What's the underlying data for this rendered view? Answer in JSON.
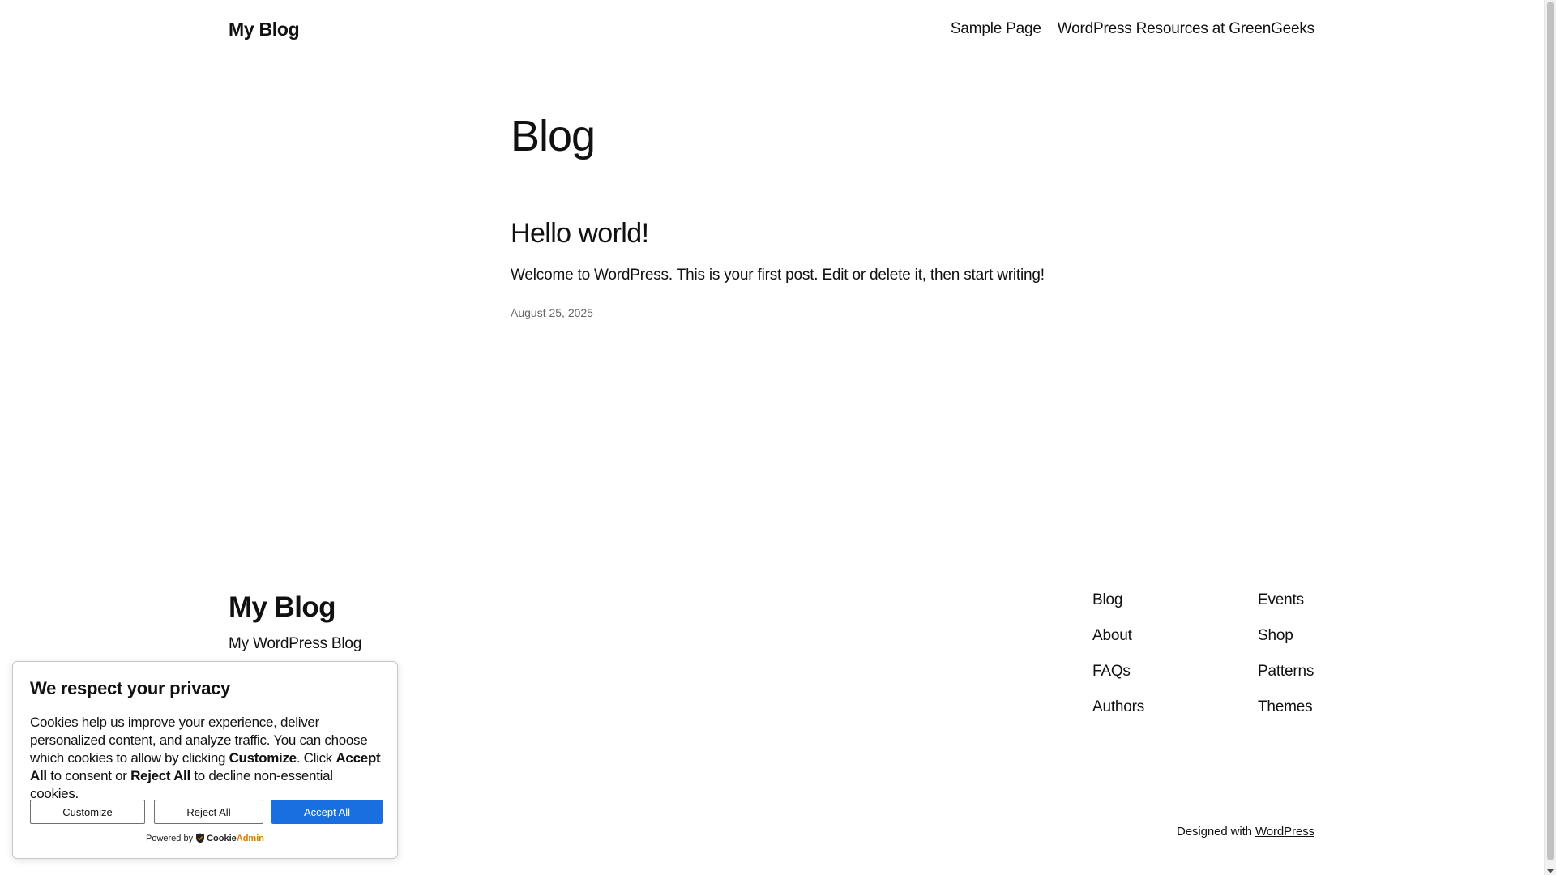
{
  "header": {
    "site_title": "My Blog",
    "nav": [
      "Sample Page",
      "WordPress Resources at GreenGeeks"
    ]
  },
  "main": {
    "page_title": "Blog",
    "posts": [
      {
        "title": "Hello world!",
        "excerpt": "Welcome to WordPress. This is your first post. Edit or delete it, then start writing!",
        "date": "August 25, 2025"
      }
    ]
  },
  "footer": {
    "title": "My Blog",
    "tagline": "My WordPress Blog",
    "columns": [
      [
        "Blog",
        "About",
        "FAQs",
        "Authors"
      ],
      [
        "Events",
        "Shop",
        "Patterns",
        "Themes"
      ]
    ],
    "credit_prefix": "Designed with",
    "credit_link": "WordPress"
  },
  "cookie_banner": {
    "title": "We respect your privacy",
    "text_1": "Cookies help us improve your experience, deliver personalized content, and analyze traffic. You can choose which cookies to allow by clicking ",
    "bold_customize": "Customize",
    "text_2": ". Click ",
    "bold_accept": "Accept All",
    "text_3": " to consent or ",
    "bold_reject": "Reject All",
    "text_4": " to decline non-essential cookies.",
    "buttons": {
      "customize": "Customize",
      "reject": "Reject All",
      "accept": "Accept All"
    },
    "powered_by": "Powered by",
    "brand_part1": "Cookie",
    "brand_part2": "Admin",
    "accent_color": "#1a6fe0",
    "brand_accent_color": "#d97a00"
  },
  "icons": {
    "brand_logo": "shield-icon",
    "scroll_down": "chevron-down-icon"
  }
}
